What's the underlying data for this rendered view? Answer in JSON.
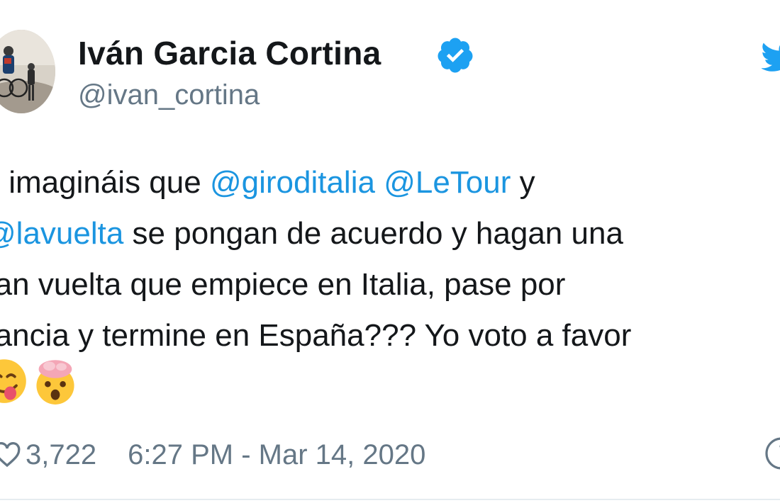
{
  "tweet": {
    "author": {
      "display_name": "Iván Garcia Cortina",
      "handle": "@ivan_cortina",
      "verified": true,
      "avatar_icon": "cyclist-photo-avatar"
    },
    "text_lines": [
      [
        {
          "text": "s imagináis que ",
          "type": "plain"
        },
        {
          "text": "@giroditalia",
          "type": "mention"
        },
        {
          "text": " ",
          "type": "plain"
        },
        {
          "text": "@LeTour",
          "type": "mention"
        },
        {
          "text": " y",
          "type": "plain"
        }
      ],
      [
        {
          "text": "@lavuelta",
          "type": "mention"
        },
        {
          "text": " se pongan de acuerdo y hagan una",
          "type": "plain"
        }
      ],
      [
        {
          "text": "ran vuelta que empiece en Italia, pase por",
          "type": "plain"
        }
      ],
      [
        {
          "text": "rancia y termine en España??? Yo voto a favor",
          "type": "plain"
        }
      ]
    ],
    "emojis": [
      "face-savoring-food-emoji",
      "exploding-head-emoji"
    ],
    "like_count": "3,722",
    "timestamp": "6:27 PM - Mar 14, 2020",
    "icons": {
      "verified": "verified-badge-icon",
      "brand": "twitter-bird-icon",
      "like": "heart-icon",
      "info": "info-icon"
    },
    "colors": {
      "text": "#14171a",
      "secondary": "#657786",
      "link": "#1b95e0",
      "verified": "#1da1f2",
      "background": "#ffffff"
    }
  }
}
